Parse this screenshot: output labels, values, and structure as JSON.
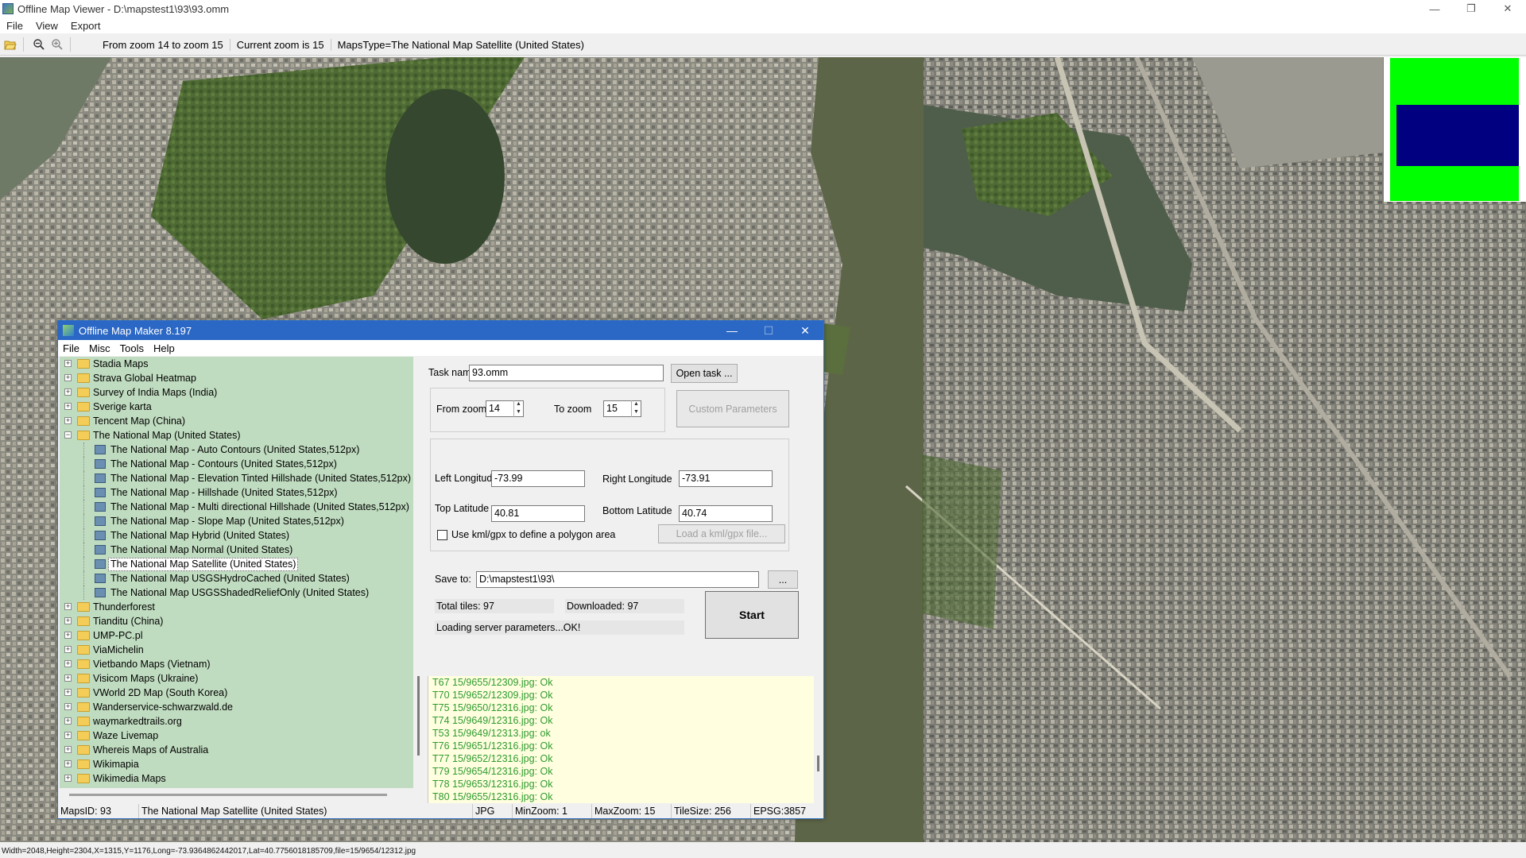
{
  "window": {
    "title": "Offline Map Viewer - D:\\mapstest1\\93\\93.omm",
    "controls": [
      "—",
      "❐",
      "✕"
    ]
  },
  "menu": [
    "File",
    "View",
    "Export"
  ],
  "toolbar": {
    "icons": [
      "open-folder-icon",
      "zoom-out-icon",
      "zoom-in-icon"
    ],
    "zoom_range": "From zoom 14 to zoom 15",
    "current_zoom": "Current zoom is 15",
    "maps_type": "MapsType=The National Map Satellite (United States)"
  },
  "status_bar": "Width=2048,Height=2304,X=1315,Y=1176,Long=-73.9364862442017,Lat=40.7756018185709,file=15/9654/12312.jpg",
  "overview_colors": {
    "frame": "#00ff00",
    "view": "#000080"
  },
  "dialog": {
    "title": "Offline Map Maker 8.197",
    "controls": [
      "—",
      "☐",
      "✕"
    ],
    "menu": [
      "File",
      "Misc",
      "Tools",
      "Help"
    ],
    "tree": {
      "folders_before": [
        "Stadia Maps",
        "Strava Global Heatmap",
        "Survey of India Maps (India)",
        "Sverige karta",
        "Tencent Map (China)"
      ],
      "expanded_folder": "The National Map (United States)",
      "children": [
        "The National Map - Auto Contours (United States,512px)",
        "The National Map - Contours (United States,512px)",
        "The National Map - Elevation Tinted Hillshade (United States,512px)",
        "The National Map - Hillshade (United States,512px)",
        "The National Map - Multi directional Hillshade (United States,512px)",
        "The National Map - Slope Map (United States,512px)",
        "The National Map Hybrid (United States)",
        "The National Map Normal (United States)",
        "The National Map Satellite (United States)",
        "The National Map USGSHydroCached (United States)",
        "The National Map USGSShadedReliefOnly (United States)"
      ],
      "selected_child": "The National Map Satellite (United States)",
      "folders_after": [
        "Thunderforest",
        "Tianditu (China)",
        "UMP-PC.pl",
        "ViaMichelin",
        "Vietbando Maps (Vietnam)",
        "Visicom Maps (Ukraine)",
        "VWorld 2D Map (South Korea)",
        "Wanderservice-schwarzwald.de",
        "waymarkedtrails.org",
        "Waze Livemap",
        "Whereis Maps of Australia",
        "Wikimapia",
        "Wikimedia Maps"
      ]
    },
    "form": {
      "task_name_label": "Task name",
      "task_name_value": "93.omm",
      "open_task_button": "Open task ...",
      "from_zoom_label": "From zoom",
      "from_zoom_value": "14",
      "to_zoom_label": "To zoom",
      "to_zoom_value": "15",
      "custom_params_button": "Custom Parameters",
      "left_lon_label": "Left Longitude",
      "left_lon_value": "-73.99",
      "right_lon_label": "Right Longitude",
      "right_lon_value": "-73.91",
      "top_lat_label": "Top Latitude",
      "top_lat_value": "40.81",
      "bottom_lat_label": "Bottom Latitude",
      "bottom_lat_value": "40.74",
      "kml_checkbox_label": "Use kml/gpx to define a polygon area",
      "load_kml_button": "Load a kml/gpx file...",
      "save_to_label": "Save to:",
      "save_to_value": "D:\\mapstest1\\93\\",
      "browse_button": "...",
      "total_tiles": "Total tiles: 97",
      "downloaded": "Downloaded: 97",
      "loading_status": "Loading server parameters...OK!",
      "start_button": "Start"
    },
    "log": [
      "T67 15/9655/12309.jpg: Ok",
      "T70 15/9652/12309.jpg: Ok",
      "T75 15/9650/12316.jpg: Ok",
      "T74 15/9649/12316.jpg: Ok",
      "T53 15/9649/12313.jpg: ok",
      "T76 15/9651/12316.jpg: Ok",
      "T77 15/9652/12316.jpg: Ok",
      "T79 15/9654/12316.jpg: Ok",
      "T78 15/9653/12316.jpg: Ok",
      "T80 15/9655/12316.jpg: Ok"
    ],
    "status": {
      "maps_id": "MapsID: 93",
      "maps_name": "The National Map Satellite (United States)",
      "format": "JPG",
      "min_zoom": "MinZoom: 1",
      "max_zoom": "MaxZoom: 15",
      "tile_size": "TileSize: 256",
      "epsg": "EPSG:3857"
    }
  }
}
